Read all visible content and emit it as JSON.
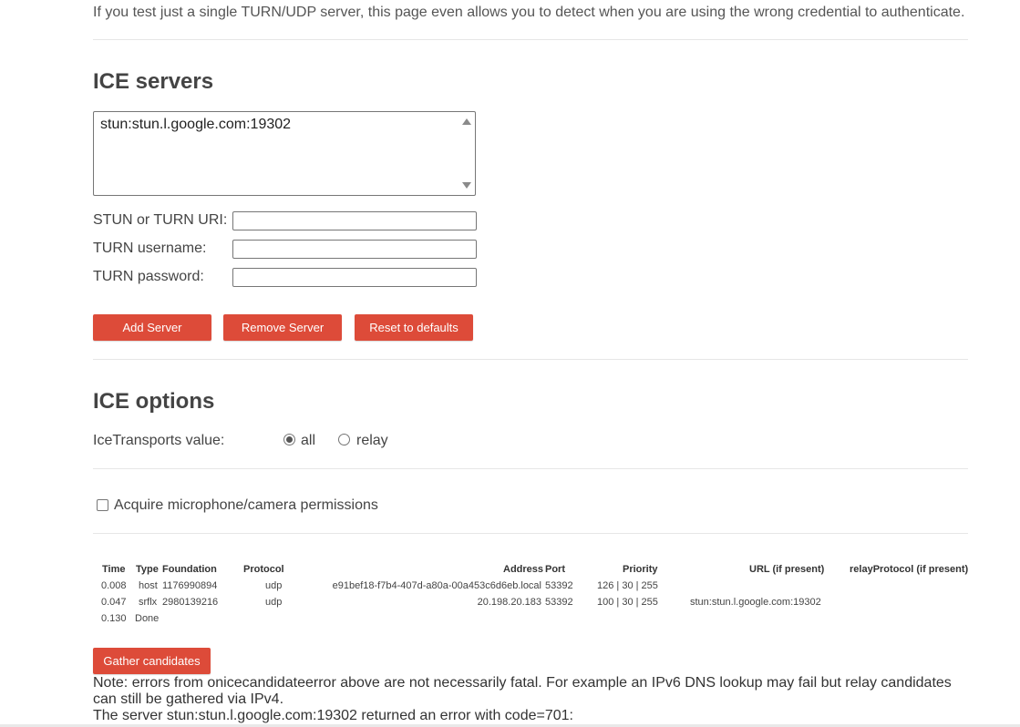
{
  "intro": "If you test just a single TURN/UDP server, this page even allows you to detect when you are using the wrong credential to authenticate.",
  "ice_servers": {
    "heading": "ICE servers",
    "list": [
      "stun:stun.l.google.com:19302"
    ],
    "fields": [
      {
        "label": "STUN or TURN URI:",
        "value": ""
      },
      {
        "label": "TURN username:",
        "value": ""
      },
      {
        "label": "TURN password:",
        "value": ""
      }
    ],
    "buttons": {
      "add": "Add Server",
      "remove": "Remove Server",
      "reset": "Reset to defaults"
    }
  },
  "ice_options": {
    "heading": "ICE options",
    "transports_label": "IceTransports value:",
    "options": [
      {
        "label": "all",
        "checked": true
      },
      {
        "label": "relay",
        "checked": false
      }
    ],
    "permissions_label": "Acquire microphone/camera permissions",
    "permissions_checked": false
  },
  "candidates": {
    "headers": {
      "time": "Time",
      "type": "Type",
      "foundation": "Foundation",
      "protocol": "Protocol",
      "address": "Address",
      "port": "Port",
      "priority": "Priority",
      "url": "URL (if present)",
      "relay": "relayProtocol (if present)"
    },
    "rows": [
      {
        "time": "0.008",
        "type": "host",
        "foundation": "1176990894",
        "protocol": "udp",
        "address": "e91bef18-f7b4-407d-a80a-00a453c6d6eb.local",
        "port": "53392",
        "priority": "126 | 30 | 255",
        "url": "",
        "relay": ""
      },
      {
        "time": "0.047",
        "type": "srflx",
        "foundation": "2980139216",
        "protocol": "udp",
        "address": "20.198.20.183",
        "port": "53392",
        "priority": "100 | 30 | 255",
        "url": "stun:stun.l.google.com:19302",
        "relay": ""
      }
    ],
    "done": {
      "time": "0.130",
      "label": "Done"
    },
    "gather_button": "Gather candidates"
  },
  "notes": [
    "Note: errors from onicecandidateerror above are not necessarily fatal. For example an IPv6 DNS lookup may fail but relay candidates can still be gathered via IPv4.",
    "The server stun:stun.l.google.com:19302 returned an error with code=701:"
  ],
  "colors": {
    "accent": "#dd4b39",
    "text": "#444444"
  }
}
